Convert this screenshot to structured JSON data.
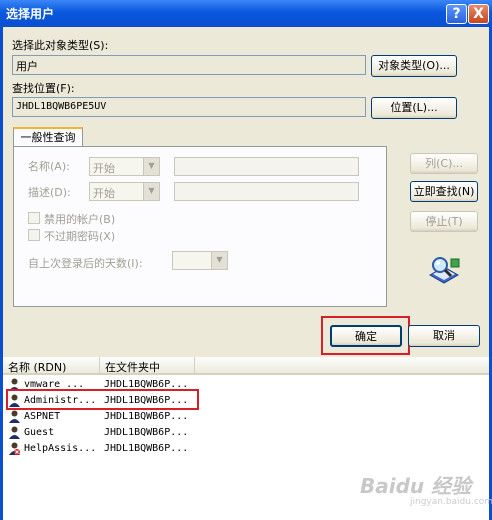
{
  "window": {
    "title": "选择用户",
    "help_label": "?",
    "close_label": "X"
  },
  "object_type": {
    "label": "选择此对象类型(S):",
    "value": "用户",
    "button_label": "对象类型(O)..."
  },
  "location": {
    "label": "查找位置(F):",
    "value": "JHDL1BQWB6PE5UV",
    "button_label": "位置(L)..."
  },
  "common_query": {
    "tab_label": "一般性查询",
    "name_label": "名称(A):",
    "name_mode": "开始",
    "desc_label": "描述(D):",
    "desc_mode": "开始",
    "disabled_accounts_label": "禁用的帐户(B)",
    "no_expire_pwd_label": "不过期密码(X)",
    "days_since_logon_label": "自上次登录后的天数(I):"
  },
  "side_buttons": {
    "columns_label": "列(C)...",
    "find_now_label": "立即查找(N)",
    "stop_label": "停止(T)"
  },
  "dialog_buttons": {
    "ok_label": "确定",
    "cancel_label": "取消"
  },
  "results": {
    "columns": [
      "名称 (RDN)",
      "在文件夹中"
    ],
    "rows": [
      {
        "name": "vmware ...",
        "folder": "JHDL1BQWB6P..."
      },
      {
        "name": "Administr...",
        "folder": "JHDL1BQWB6P..."
      },
      {
        "name": "ASPNET",
        "folder": "JHDL1BQWB6P..."
      },
      {
        "name": "Guest",
        "folder": "JHDL1BQWB6P..."
      },
      {
        "name": "HelpAssis...",
        "folder": "JHDL1BQWB6P..."
      }
    ]
  },
  "watermark": {
    "logo": "Baidu 经验",
    "url": "jingyan.baidu.com"
  }
}
